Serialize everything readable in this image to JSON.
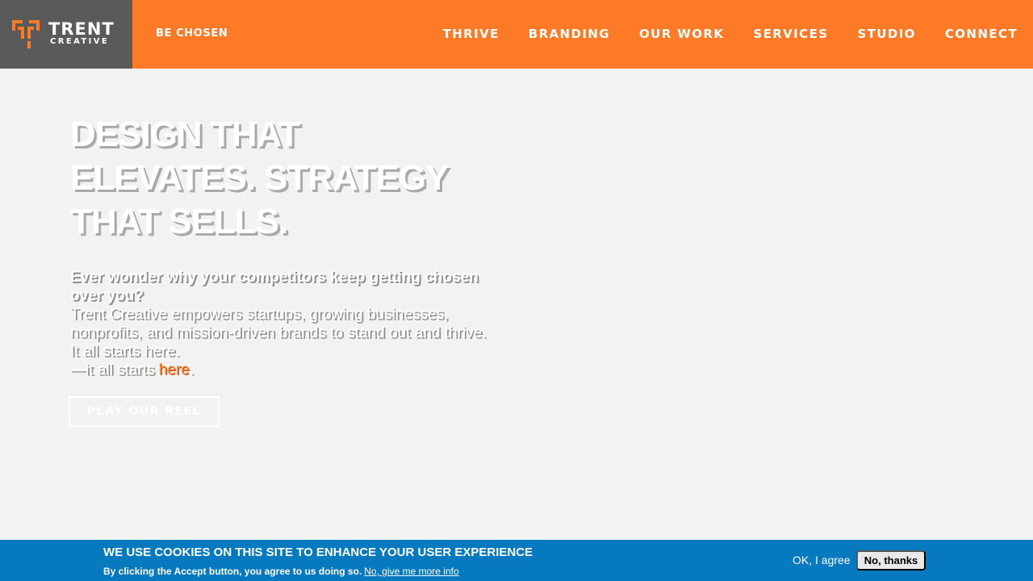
{
  "brand": {
    "name": "TRENT",
    "sub": "CREATIVE",
    "tagline": "BE CHOSEN",
    "colors": {
      "orange": "#ff7a26",
      "gray": "#5a5a5a",
      "cookie_blue": "#0779bf"
    }
  },
  "nav": {
    "items": [
      {
        "label": "THRIVE"
      },
      {
        "label": "BRANDING"
      },
      {
        "label": "OUR WORK"
      },
      {
        "label": "SERVICES"
      },
      {
        "label": "STUDIO"
      },
      {
        "label": "CONNECT"
      }
    ]
  },
  "hero": {
    "title": "DESIGN THAT ELEVATES. STRATEGY THAT SELLS.",
    "question": "Ever wonder why your competitors keep getting chosen over you?",
    "body": "Trent Creative empowers startups, growing businesses, nonprofits, and mission-driven brands to stand out and thrive. It all starts here.",
    "tail_prefix": "—it all starts ",
    "tail_link": "here",
    "tail_suffix": ".",
    "button": "PLAY OUR REEL"
  },
  "cookie": {
    "title": "WE USE COOKIES ON THIS SITE TO ENHANCE YOUR USER EXPERIENCE",
    "text": "By clicking the Accept button, you agree to us doing so.",
    "link": "No, give me more info",
    "ok": "OK, I agree",
    "no": "No, thanks"
  }
}
